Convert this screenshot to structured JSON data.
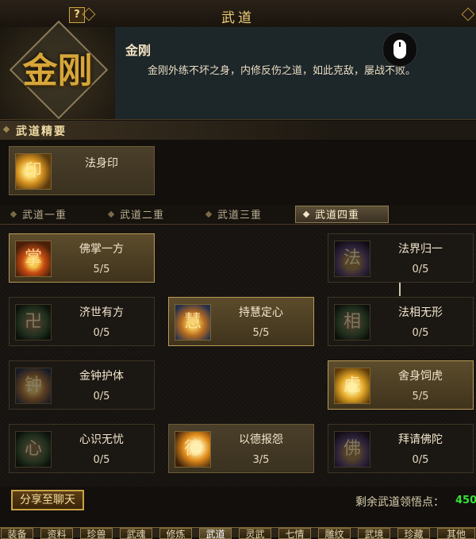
{
  "window": {
    "title": "武道",
    "help_label": "?"
  },
  "header": {
    "emblem_text": "金刚",
    "skill_name": "金刚",
    "skill_desc": "金刚外练不坏之身，内修反伤之道，如此克敌，屡战不败。"
  },
  "essence_section": {
    "title": "武道精要",
    "item": {
      "label": "法身印",
      "icon": "dharma-seal-icon"
    }
  },
  "tabs": [
    {
      "label": "武道一重",
      "active": false
    },
    {
      "label": "武道二重",
      "active": false
    },
    {
      "label": "武道三重",
      "active": false
    },
    {
      "label": "武道四重",
      "active": true
    }
  ],
  "skills": [
    {
      "label": "佛掌一方",
      "count": "5/5",
      "icon": "buddha-palm-icon",
      "state": "learned"
    },
    {
      "label": "法界归一",
      "count": "0/5",
      "icon": "dharma-realm-icon",
      "state": "locked"
    },
    {
      "label": "济世有方",
      "count": "0/5",
      "icon": "swastika-icon",
      "state": "locked"
    },
    {
      "label": "持慧定心",
      "count": "5/5",
      "icon": "wisdom-icon",
      "state": "learned"
    },
    {
      "label": "法相无形",
      "count": "0/5",
      "icon": "formless-icon",
      "state": "locked"
    },
    {
      "label": "金钟护体",
      "count": "0/5",
      "icon": "golden-bell-icon",
      "state": "locked"
    },
    {
      "label": "舍身饲虎",
      "count": "5/5",
      "icon": "sacrifice-tiger-icon",
      "state": "learned"
    },
    {
      "label": "心识无忧",
      "count": "0/5",
      "icon": "mind-carefree-icon",
      "state": "locked"
    },
    {
      "label": "以德报怨",
      "count": "3/5",
      "icon": "virtue-icon",
      "state": "partial"
    },
    {
      "label": "拜请佛陀",
      "count": "0/5",
      "icon": "invoke-buddha-icon",
      "state": "locked"
    }
  ],
  "footer": {
    "share_label": "分享至聊天",
    "points_label": "剩余武道领悟点：",
    "points_value": "450"
  },
  "bottom_tabs": [
    {
      "label": "装备",
      "active": false
    },
    {
      "label": "资料",
      "active": false
    },
    {
      "label": "珍兽",
      "active": false
    },
    {
      "label": "武魂",
      "active": false
    },
    {
      "label": "修炼",
      "active": false
    },
    {
      "label": "武道",
      "active": true
    },
    {
      "label": "灵武",
      "active": false
    },
    {
      "label": "七情",
      "active": false
    },
    {
      "label": "雕纹",
      "active": false
    },
    {
      "label": "武境",
      "active": false
    },
    {
      "label": "珍藏",
      "active": false
    },
    {
      "label": "其他",
      "active": false
    }
  ],
  "colors": {
    "accent_gold": "#c9a244",
    "points_green": "#35e23a",
    "panel_bg": "#1d2629"
  }
}
